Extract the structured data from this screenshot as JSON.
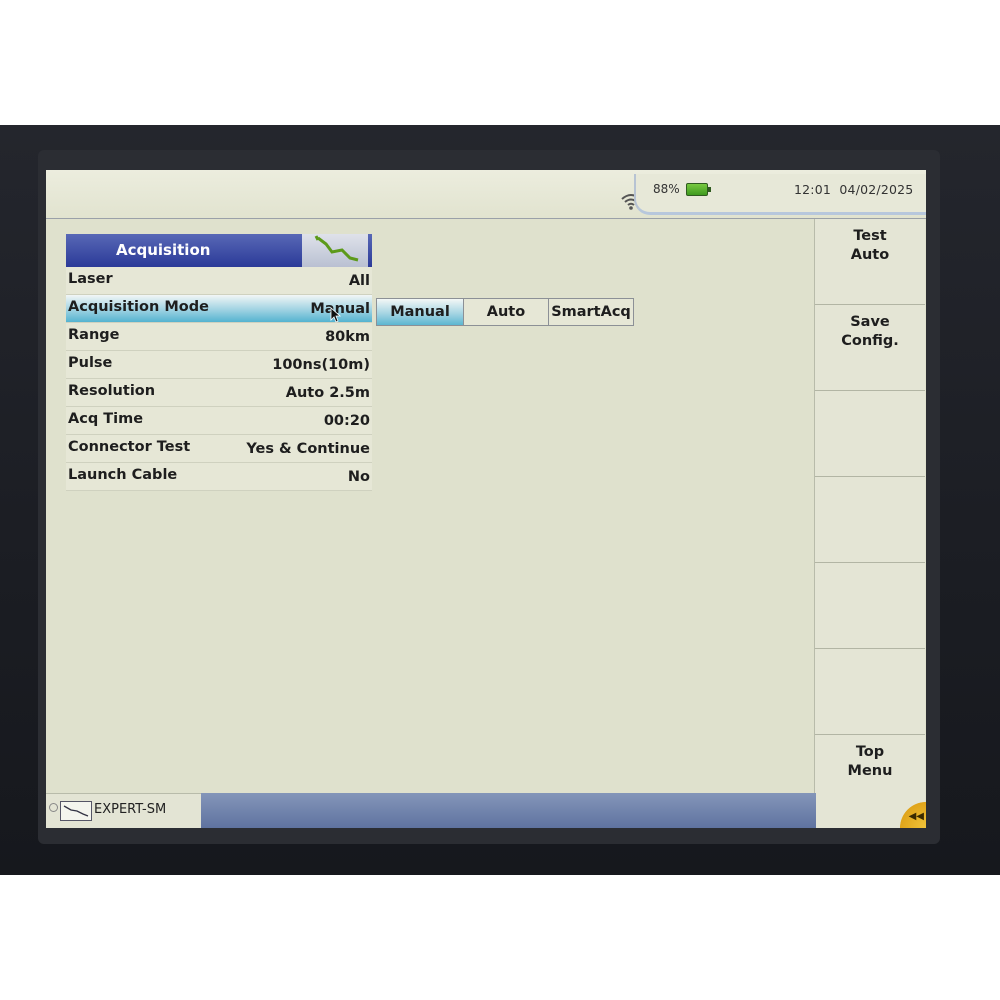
{
  "status": {
    "battery_percent": "88%",
    "time": "12:01",
    "date": "04/02/2025"
  },
  "panel": {
    "title": "Acquisition",
    "rows": [
      {
        "label": "Laser",
        "value": "All"
      },
      {
        "label": "Acquisition Mode",
        "value": "Manual"
      },
      {
        "label": "Range",
        "value": "80km"
      },
      {
        "label": "Pulse",
        "value": "100ns(10m)"
      },
      {
        "label": "Resolution",
        "value": "Auto 2.5m"
      },
      {
        "label": "Acq Time",
        "value": "00:20"
      },
      {
        "label": "Connector Test",
        "value": "Yes & Continue"
      },
      {
        "label": "Launch Cable",
        "value": "No"
      }
    ]
  },
  "mode_options": {
    "items": [
      "Manual",
      "Auto",
      "SmartAcq"
    ],
    "selected": "Manual"
  },
  "softkeys": {
    "test_auto": {
      "line1": "Test",
      "line2": "Auto"
    },
    "save_config": {
      "line1": "Save",
      "line2": "Config."
    },
    "top_menu": {
      "line1": "Top",
      "line2": "Menu"
    }
  },
  "bottombar": {
    "app_label": "EXPERT-SM"
  }
}
